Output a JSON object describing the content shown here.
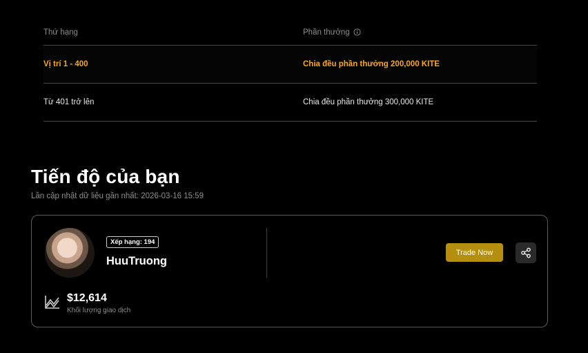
{
  "rewards_table": {
    "headers": {
      "rank": "Thứ hạng",
      "reward": "Phần thưởng"
    },
    "rows": [
      {
        "rank": "Vị trí 1 - 400",
        "reward": "Chia đều phần thưởng 200,000 KITE"
      },
      {
        "rank": "Từ 401 trở lên",
        "reward": "Chia đều phần thưởng 300,000 KITE"
      }
    ]
  },
  "progress": {
    "title": "Tiến độ của bạn",
    "updated": "Lần cập nhật dữ liệu gần nhất: 2026-03-16 15:59"
  },
  "card": {
    "rank_badge": "Xếp hạng: 194",
    "username": "HuuTruong",
    "trade_button": "Trade Now",
    "volume": "$12,614",
    "volume_label": "Khối lượng giao dịch"
  },
  "colors": {
    "accent": "#f5a623",
    "button": "#b58f10"
  }
}
